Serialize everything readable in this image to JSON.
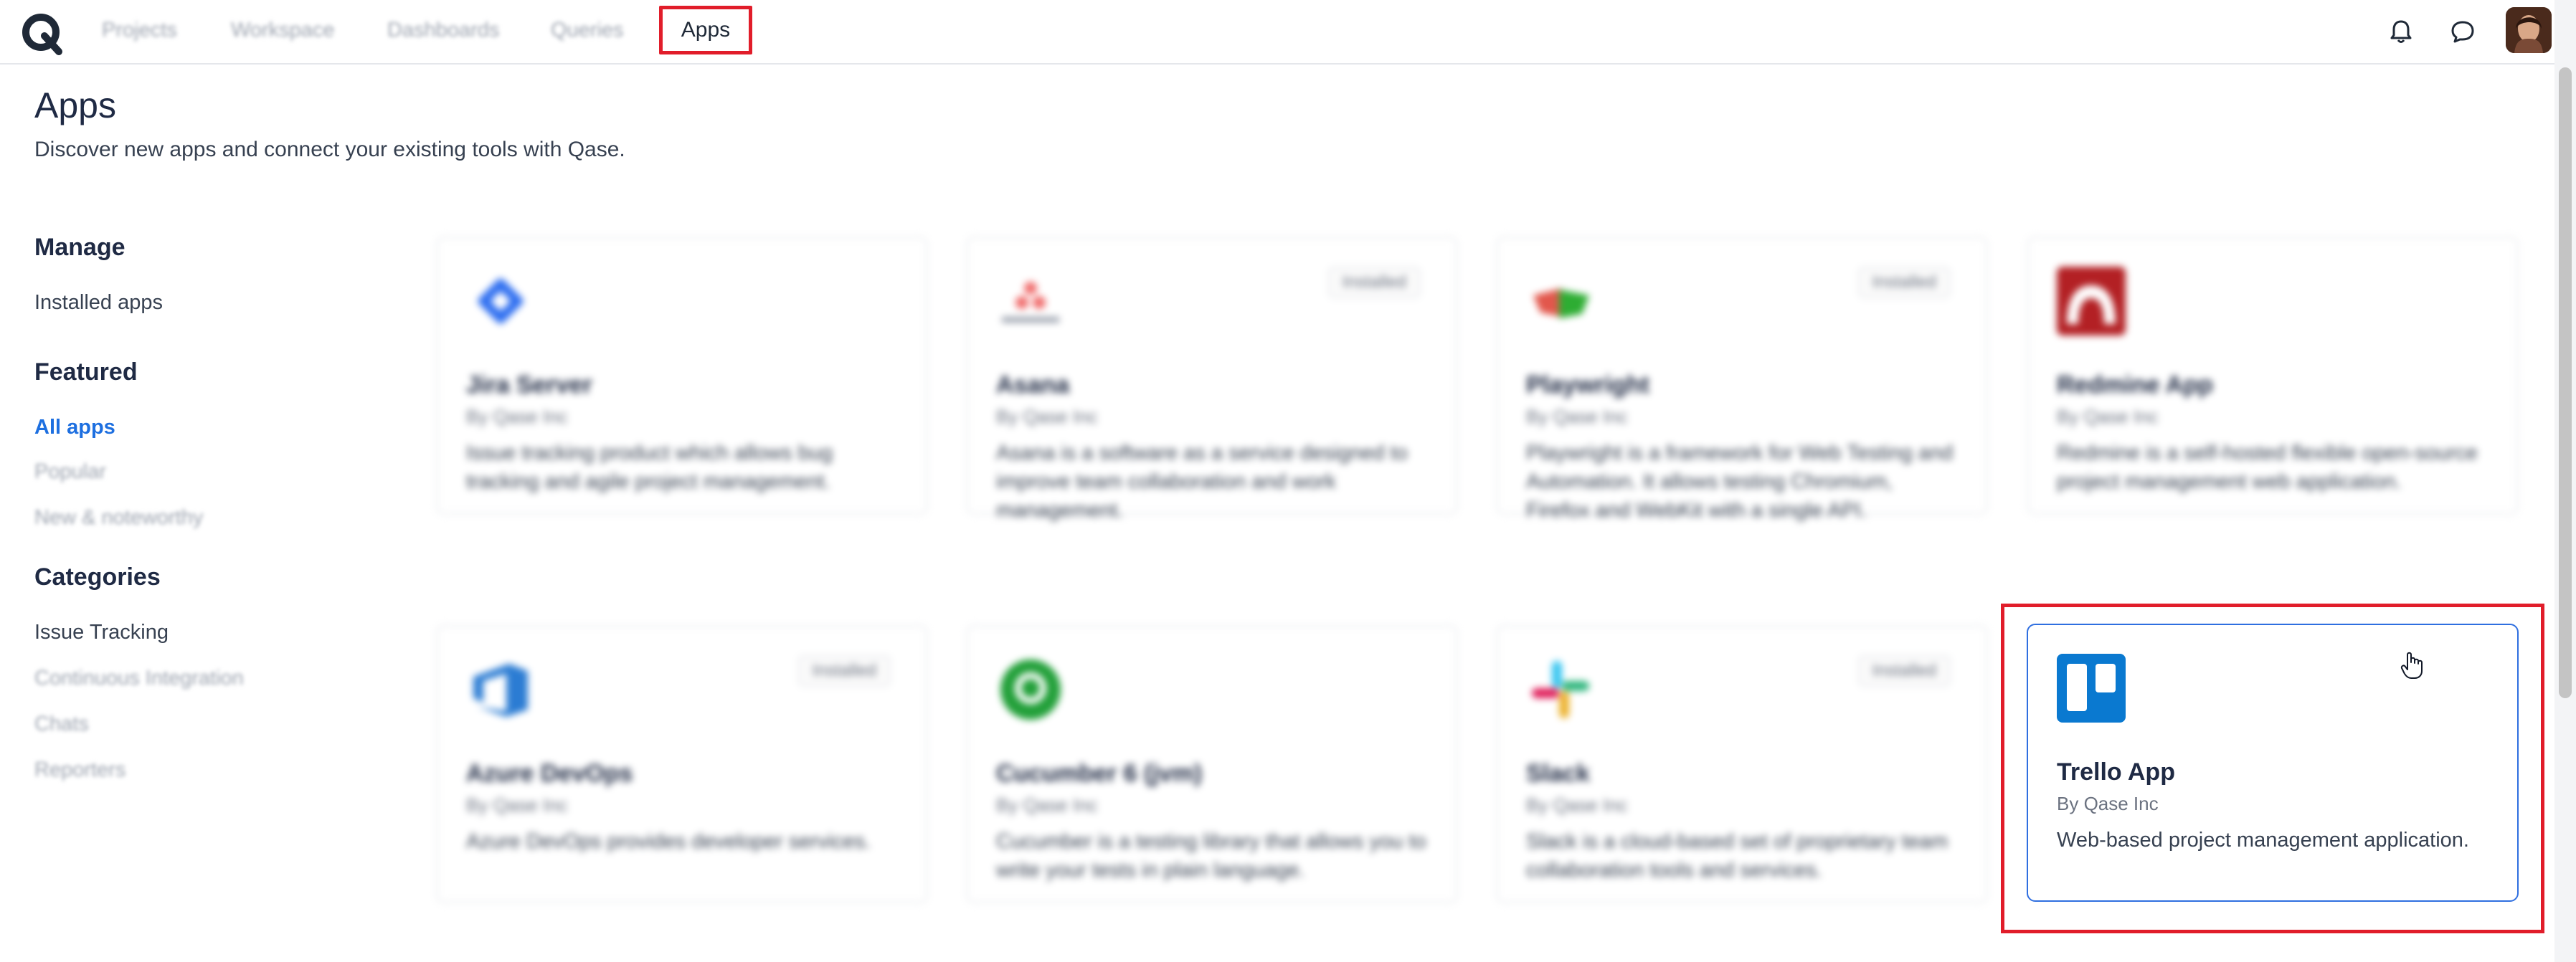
{
  "nav": {
    "items": [
      "Projects",
      "Workspace",
      "Dashboards",
      "Queries"
    ],
    "active": "Apps"
  },
  "page": {
    "title": "Apps",
    "subtitle": "Discover new apps and connect your existing tools with Qase."
  },
  "sidebar": {
    "manage_heading": "Manage",
    "installed_apps": "Installed apps",
    "featured_heading": "Featured",
    "all_apps": "All apps",
    "popular": "Popular",
    "new_noteworthy": "New & noteworthy",
    "categories_heading": "Categories",
    "issue_tracking": "Issue Tracking",
    "ci": "Continuous Integration",
    "chats": "Chats",
    "reporters": "Reporters"
  },
  "cards": [
    {
      "name": "Jira Server",
      "by": "By Qase Inc",
      "desc": "Issue tracking product which allows bug tracking and agile project management.",
      "installed": "",
      "icon": "jira-icon"
    },
    {
      "name": "Asana",
      "by": "By Qase Inc",
      "desc": "Asana is a software as a service designed to improve team collaboration and work management.",
      "installed": "Installed",
      "icon": "asana-icon"
    },
    {
      "name": "Playwright",
      "by": "By Qase Inc",
      "desc": "Playwright is a framework for Web Testing and Automation. It allows testing Chromium, Firefox and WebKit with a single API.",
      "installed": "Installed",
      "icon": "playwright-icon"
    },
    {
      "name": "Redmine App",
      "by": "By Qase Inc",
      "desc": "Redmine is a self-hosted flexible open-source project management web application.",
      "installed": "",
      "icon": "redmine-icon"
    },
    {
      "name": "Azure DevOps",
      "by": "By Qase Inc",
      "desc": "Azure DevOps provides developer services.",
      "installed": "Installed",
      "icon": "azure-devops-icon"
    },
    {
      "name": "Cucumber 6 (jvm)",
      "by": "By Qase Inc",
      "desc": "Cucumber is a testing library that allows you to write your tests in plain language.",
      "installed": "",
      "icon": "cucumber-icon"
    },
    {
      "name": "Slack",
      "by": "By Qase Inc",
      "desc": "Slack is a cloud-based set of proprietary team collaboration tools and services.",
      "installed": "Installed",
      "icon": "slack-icon"
    },
    {
      "name": "Trello App",
      "by": "By Qase Inc",
      "desc": "Web-based project management application.",
      "installed": "",
      "icon": "trello-icon"
    }
  ],
  "colors": {
    "accent": "#1d6fe0",
    "highlight": "#e11d2a",
    "trello": "#0a79d0"
  }
}
